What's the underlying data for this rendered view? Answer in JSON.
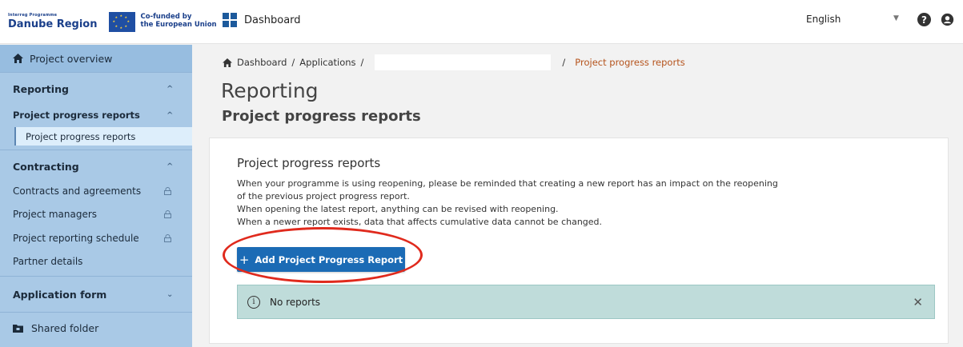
{
  "header": {
    "logo_programme": "Interreg Programme",
    "logo_name": "Danube Region",
    "eu_line1": "Co-funded by",
    "eu_line2": "the European Union",
    "dashboard_label": "Dashboard",
    "language": "English",
    "help_icon_glyph": "?"
  },
  "sidebar": {
    "project_overview": "Project overview",
    "reporting_header": "Reporting",
    "progress_reports_sub": "Project progress reports",
    "progress_reports_item": "Project progress reports",
    "contracting_header": "Contracting",
    "contracting_items": [
      "Contracts and agreements",
      "Project managers",
      "Project reporting schedule",
      "Partner details"
    ],
    "application_form_header": "Application form",
    "shared_folder": "Shared folder"
  },
  "breadcrumb": {
    "dashboard": "Dashboard",
    "applications": "Applications",
    "current": "Project progress reports"
  },
  "main": {
    "title": "Reporting",
    "subtitle": "Project progress reports",
    "card_title": "Project progress reports",
    "info_lines": [
      "When your programme is using reopening, please be reminded that creating a new report has an impact on the reopening",
      "of the previous project progress report.",
      "When opening the latest report, anything can be revised with reopening.",
      "When a newer report exists, data that affects cumulative data cannot be changed."
    ],
    "add_button_label": "Add Project Progress Report",
    "alert_text": "No reports"
  },
  "colors": {
    "sidebar_bg": "#a9c9e6",
    "primary_button": "#1b6bb5",
    "breadcrumb_current": "#b5531c",
    "alert_bg": "#bfdcda",
    "highlight": "#e02a1d"
  }
}
